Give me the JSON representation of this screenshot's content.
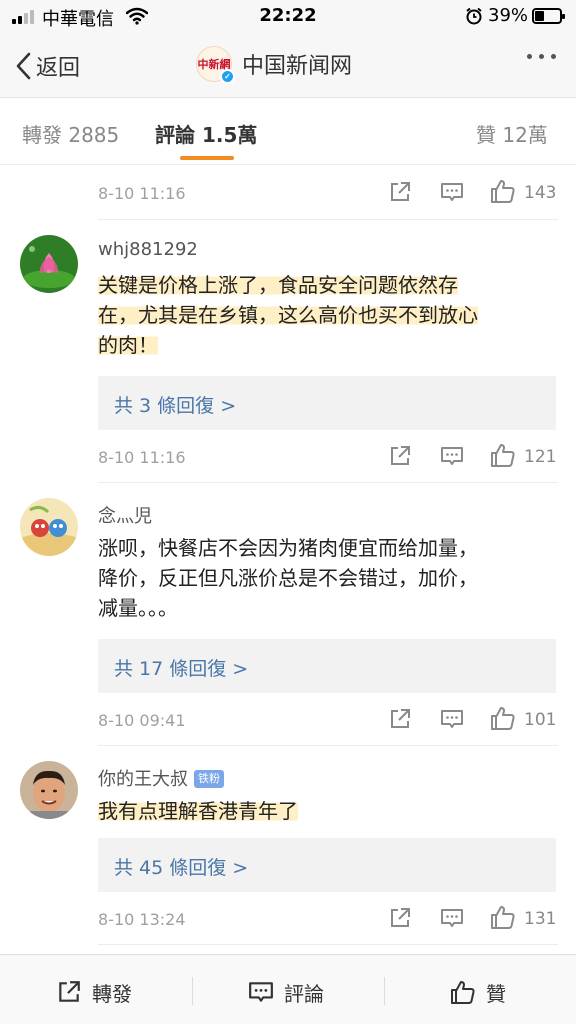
{
  "status_bar": {
    "carrier": "中華電信",
    "time": "22:22",
    "battery_percent": "39%",
    "battery_level": 0.39,
    "icons": [
      "signal-icon",
      "wifi-icon",
      "alarm-icon",
      "battery-icon"
    ]
  },
  "nav": {
    "back_label": "返回",
    "title": "中国新闻网",
    "logo_text": "中新網"
  },
  "tabs": {
    "repost": "轉發 2885",
    "comments": "評論 1.5萬",
    "likes": "贊 12萬",
    "active": "comments"
  },
  "comments": [
    {
      "time": "8-10 11:16",
      "likes": "143"
    },
    {
      "username": "whj881292",
      "text_lines": [
        "关键是价格上涨了，食品安全问题依然存",
        "在，尤其是在乡镇，这么高价也买不到放心",
        "的肉！"
      ],
      "replies": "共 3 條回復 >",
      "time": "8-10 11:16",
      "likes": "121"
    },
    {
      "username": "念灬児",
      "text_lines": [
        "涨呗，快餐店不会因为猪肉便宜而给加量，",
        "降价，反正但凡涨价总是不会错过，加价，",
        "减量。。。"
      ],
      "replies": "共 17 條回復 >",
      "time": "8-10 09:41",
      "likes": "101"
    },
    {
      "username": "你的王大叔",
      "badge": "铁粉",
      "text_lines": [
        "我有点理解香港青年了"
      ],
      "replies": "共 45 條回復 >",
      "time": "8-10 13:24",
      "likes": "131"
    }
  ],
  "bottom_bar": {
    "repost": "轉發",
    "comment": "評論",
    "like": "贊"
  },
  "colors": {
    "accent": "#f28b24",
    "link": "#4a76a8",
    "highlight": "#ffe296"
  }
}
